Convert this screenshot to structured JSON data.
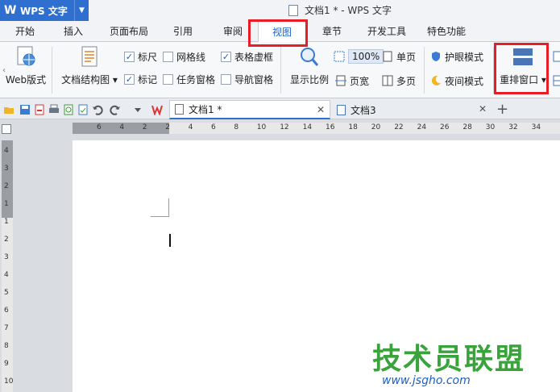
{
  "titlebar": {
    "logo": "W",
    "app_name": "WPS 文字",
    "window_title": "文档1 * - WPS 文字"
  },
  "tabs": [
    {
      "label": "开始"
    },
    {
      "label": "插入"
    },
    {
      "label": "页面布局"
    },
    {
      "label": "引用"
    },
    {
      "label": "审阅"
    },
    {
      "label": "视图"
    },
    {
      "label": "章节"
    },
    {
      "label": "开发工具"
    },
    {
      "label": "特色功能"
    }
  ],
  "ribbon": {
    "web_layout": "Web版式",
    "doc_structure": "文档结构图",
    "ruler": "标尺",
    "gridlines": "网格线",
    "table_gridlines": "表格虚框",
    "marks": "标记",
    "task_pane": "任务窗格",
    "nav_pane": "导航窗格",
    "zoom": "显示比例",
    "zoom_value": "100%",
    "single_page": "单页",
    "page_width": "页宽",
    "multi_page": "多页",
    "eye_mode": "护眼模式",
    "night_mode": "夜间模式",
    "arrange_windows": "重排窗口"
  },
  "checkboxes": {
    "ruler": true,
    "gridlines": false,
    "table_gridlines": true,
    "marks": true,
    "task_pane": false,
    "nav_pane": false
  },
  "doc_tabs": [
    {
      "label": "文档1 *",
      "active": true
    },
    {
      "label": "文档3",
      "active": false
    }
  ],
  "hruler_numbers": [
    "6",
    "4",
    "2",
    "2",
    "4",
    "6",
    "8",
    "10",
    "12",
    "14",
    "16",
    "18",
    "20",
    "22",
    "24",
    "26",
    "28",
    "30",
    "32",
    "34"
  ],
  "vruler_numbers": [
    "4",
    "3",
    "2",
    "1",
    "1",
    "2",
    "3",
    "4",
    "5",
    "6",
    "7",
    "8",
    "9",
    "10"
  ],
  "watermark": {
    "text": "技术员联盟",
    "url": "www.jsgho.com"
  },
  "colors": {
    "accent": "#2e6fcf",
    "highlight_red": "#e81d25",
    "active_tab_text": "#1f63c7"
  }
}
